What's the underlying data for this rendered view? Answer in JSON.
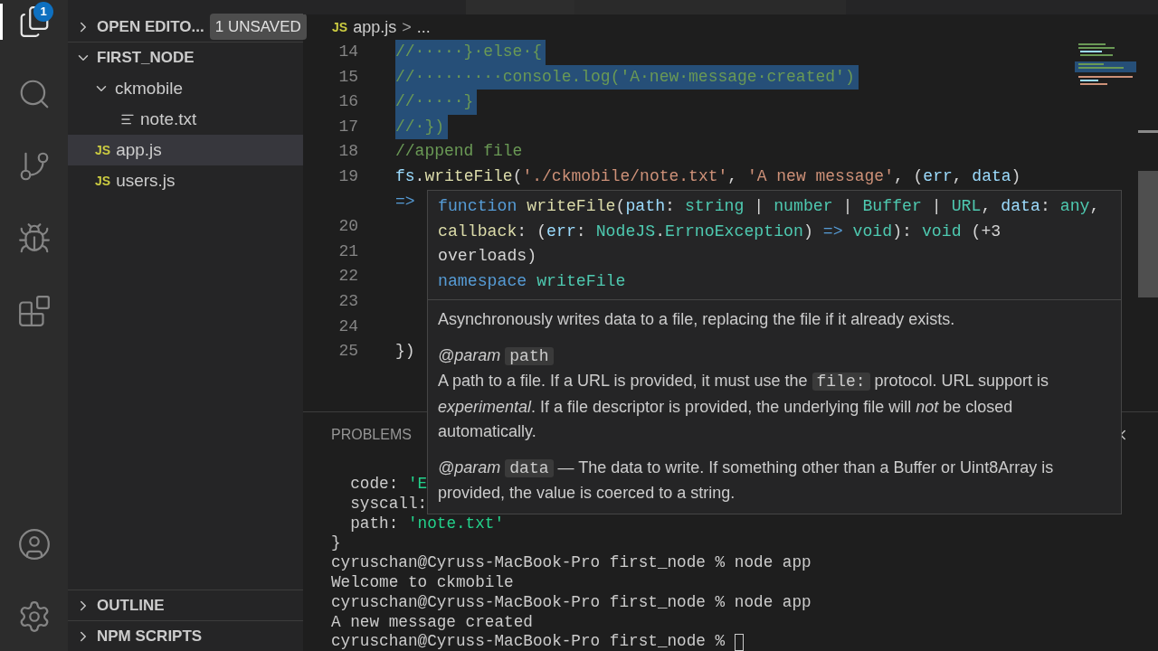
{
  "activity_bar": {
    "top": [
      {
        "kind": "explorer",
        "selected": true,
        "badge": "1"
      },
      {
        "kind": "search",
        "selected": false
      },
      {
        "kind": "source-control",
        "selected": false
      },
      {
        "kind": "run",
        "selected": false
      },
      {
        "kind": "extensions",
        "selected": false
      }
    ],
    "bottom": [
      {
        "kind": "account",
        "selected": false
      },
      {
        "kind": "settings",
        "selected": false
      }
    ]
  },
  "sidebar": {
    "open_editors": {
      "label": "OPEN EDITO...",
      "expanded": false,
      "badge": "1 UNSAVED"
    },
    "items": [
      {
        "label": "FIRST_NODE",
        "kind": "root",
        "expanded": true,
        "selected": false,
        "children": [
          {
            "label": "ckmobile",
            "kind": "folder",
            "expanded": true,
            "selected": false,
            "children": [
              {
                "label": "note.txt",
                "kind": "text-file",
                "selected": false
              }
            ]
          },
          {
            "label": "app.js",
            "kind": "js",
            "badge": "JS",
            "selected": true
          },
          {
            "label": "users.js",
            "kind": "js",
            "badge": "JS",
            "selected": false
          }
        ]
      }
    ],
    "bottom_sections": [
      {
        "label": "OUTLINE",
        "expanded": false
      },
      {
        "label": "NPM SCRIPTS",
        "expanded": false
      }
    ]
  },
  "breadcrumb": {
    "badge": "JS",
    "file": "app.js",
    "separator": ">",
    "trail": "..."
  },
  "editor": {
    "lines": [
      {
        "number": "14",
        "selected": true,
        "tokens": [
          {
            "kind": "comment",
            "text": "//·····}·else·{"
          }
        ]
      },
      {
        "number": "15",
        "selected": true,
        "tokens": [
          {
            "kind": "comment",
            "text": "//·········console.log('A·new·message·created')"
          }
        ]
      },
      {
        "number": "16",
        "selected": true,
        "tokens": [
          {
            "kind": "comment",
            "text": "//·····}"
          }
        ]
      },
      {
        "number": "17",
        "selected": true,
        "tokens": [
          {
            "kind": "comment",
            "text": "//·})"
          }
        ]
      },
      {
        "number": "18",
        "selected": false,
        "tokens": [
          {
            "kind": "comment",
            "text": "//append file"
          }
        ]
      },
      {
        "number": "19",
        "selected": false,
        "tokens": [
          {
            "kind": "ident",
            "text": "fs"
          },
          {
            "kind": "punct",
            "text": "."
          },
          {
            "kind": "func",
            "text": "writeFile"
          },
          {
            "kind": "punct",
            "text": "("
          },
          {
            "kind": "string",
            "text": "'./ckmobile/note.txt'"
          },
          {
            "kind": "punct",
            "text": ", "
          },
          {
            "kind": "string",
            "text": "'A new message'"
          },
          {
            "kind": "punct",
            "text": ", ("
          },
          {
            "kind": "ident",
            "text": "err"
          },
          {
            "kind": "punct",
            "text": ", "
          },
          {
            "kind": "ident",
            "text": "data"
          },
          {
            "kind": "punct",
            "text": ")"
          }
        ]
      },
      {
        "selected": false,
        "tokens": [
          {
            "kind": "keyword",
            "text": "=>"
          }
        ]
      },
      {
        "number": "20"
      },
      {
        "number": "21"
      },
      {
        "number": "22"
      },
      {
        "number": "23"
      },
      {
        "number": "24"
      },
      {
        "number": "25",
        "selected": false,
        "tokens": [
          {
            "kind": "punct",
            "text": "})"
          }
        ]
      }
    ]
  },
  "hover": {
    "signature": [
      [
        {
          "kind": "keyword",
          "text": "function"
        },
        {
          "kind": "func",
          "text": " writeFile"
        },
        {
          "kind": "punct",
          "text": "("
        },
        {
          "kind": "ident",
          "text": "path"
        },
        {
          "kind": "punct",
          "text": ": "
        },
        {
          "kind": "type",
          "text": "string"
        },
        {
          "kind": "punct",
          "text": " | "
        },
        {
          "kind": "type",
          "text": "number"
        },
        {
          "kind": "punct",
          "text": " | "
        },
        {
          "kind": "type",
          "text": "Buffer"
        },
        {
          "kind": "punct",
          "text": " | "
        },
        {
          "kind": "type",
          "text": "URL"
        },
        {
          "kind": "punct",
          "text": ", "
        },
        {
          "kind": "ident",
          "text": "data"
        },
        {
          "kind": "punct",
          "text": ": "
        },
        {
          "kind": "type",
          "text": "any"
        },
        {
          "kind": "punct",
          "text": ","
        }
      ],
      [
        {
          "kind": "func",
          "text": "callback"
        },
        {
          "kind": "punct",
          "text": ": ("
        },
        {
          "kind": "ident",
          "text": "err"
        },
        {
          "kind": "punct",
          "text": ": "
        },
        {
          "kind": "type",
          "text": "NodeJS"
        },
        {
          "kind": "punct",
          "text": "."
        },
        {
          "kind": "type",
          "text": "ErrnoException"
        },
        {
          "kind": "punct",
          "text": ") "
        },
        {
          "kind": "keyword",
          "text": "=>"
        },
        {
          "kind": "type",
          "text": " void"
        },
        {
          "kind": "punct",
          "text": "): "
        },
        {
          "kind": "type",
          "text": "void"
        },
        {
          "kind": "punct",
          "text": " (+3"
        }
      ],
      [
        {
          "kind": "punct",
          "text": "overloads)"
        }
      ],
      [
        {
          "kind": "keyword",
          "text": "namespace"
        },
        {
          "kind": "type",
          "text": " writeFile"
        }
      ]
    ],
    "summary": "Asynchronously writes data to a file, replacing the file if it already exists.",
    "params": [
      {
        "tag": "@param",
        "name": "path",
        "inline": false,
        "description": [
          {
            "kind": "text",
            "text": "A path to a file. If a URL is provided, it must use the "
          },
          {
            "kind": "code",
            "text": "file:"
          },
          {
            "kind": "text",
            "text": " protocol. URL support is *experimental*. If a file descriptor is provided, the underlying file will *not* be closed automatically."
          }
        ]
      },
      {
        "tag": "@param",
        "name": "data",
        "inline": true,
        "description": [
          {
            "kind": "text",
            "text": "— The data to write. If something other than a Buffer or Uint8Array is provided, the value is coerced to a string."
          }
        ]
      }
    ]
  },
  "panel": {
    "tabs": [
      {
        "label": "PROBLEMS",
        "selected": false
      }
    ],
    "terminal": [
      {
        "cursor": false,
        "tokens": [
          {
            "kind": "text",
            "text": "  code: "
          },
          {
            "kind": "string",
            "text": "'E"
          }
        ]
      },
      {
        "cursor": false,
        "tokens": [
          {
            "kind": "text",
            "text": "  syscall:"
          }
        ]
      },
      {
        "cursor": false,
        "tokens": [
          {
            "kind": "text",
            "text": "  path: "
          },
          {
            "kind": "string",
            "text": "'note.txt'"
          }
        ]
      },
      {
        "cursor": false,
        "tokens": [
          {
            "kind": "text",
            "text": "}"
          }
        ]
      },
      {
        "cursor": false,
        "tokens": [
          {
            "kind": "text",
            "text": "cyruschan@Cyruss-MacBook-Pro first_node % node app"
          }
        ]
      },
      {
        "cursor": false,
        "tokens": [
          {
            "kind": "text",
            "text": "Welcome to ckmobile"
          }
        ]
      },
      {
        "cursor": false,
        "tokens": [
          {
            "kind": "text",
            "text": "cyruschan@Cyruss-MacBook-Pro first_node % node app"
          }
        ]
      },
      {
        "cursor": false,
        "tokens": [
          {
            "kind": "text",
            "text": "A new message created"
          }
        ]
      },
      {
        "cursor": true,
        "tokens": [
          {
            "kind": "text",
            "text": "cyruschan@Cyruss-MacBook-Pro first_node % "
          }
        ]
      }
    ]
  }
}
